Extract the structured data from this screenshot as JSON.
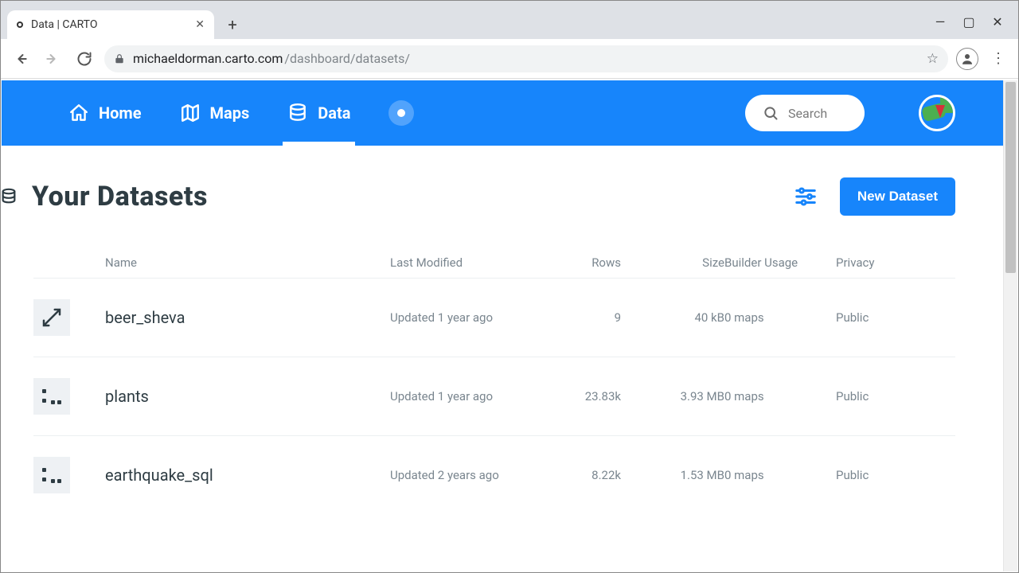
{
  "browser": {
    "tab_title": "Data | CARTO",
    "url_host": "michaeldorman.carto.com",
    "url_path": "/dashboard/datasets/"
  },
  "nav": {
    "home": "Home",
    "maps": "Maps",
    "data": "Data",
    "search_placeholder": "Search"
  },
  "page": {
    "title": "Your Datasets",
    "new_button": "New Dataset"
  },
  "columns": {
    "name": "Name",
    "modified": "Last Modified",
    "rows": "Rows",
    "size": "Size",
    "usage": "Builder Usage",
    "privacy": "Privacy"
  },
  "datasets": [
    {
      "name": "beer_sheva",
      "modified": "Updated 1 year ago",
      "rows": "9",
      "size": "40 kB",
      "usage": "0 maps",
      "privacy": "Public",
      "thumb": "line"
    },
    {
      "name": "plants",
      "modified": "Updated 1 year ago",
      "rows": "23.83k",
      "size": "3.93 MB",
      "usage": "0 maps",
      "privacy": "Public",
      "thumb": "dots"
    },
    {
      "name": "earthquake_sql",
      "modified": "Updated 2 years ago",
      "rows": "8.22k",
      "size": "1.53 MB",
      "usage": "0 maps",
      "privacy": "Public",
      "thumb": "dots"
    }
  ]
}
